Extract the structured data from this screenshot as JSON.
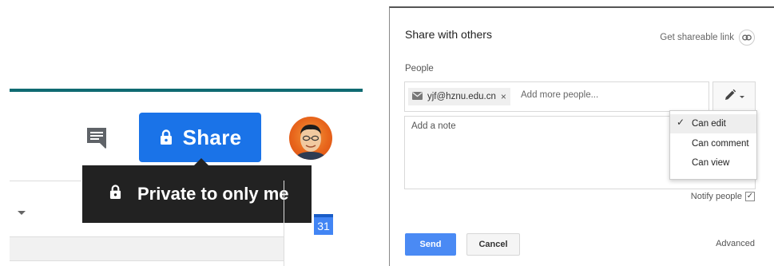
{
  "left": {
    "share_button": {
      "label": "Share",
      "icon": "lock-icon",
      "color": "#1a73e8"
    },
    "tooltip": {
      "text": "Private to only me",
      "icon": "lock-icon"
    },
    "comment_icon": "comment-icon",
    "calendar_icon": {
      "label": "31"
    },
    "accent_bar_color": "#0f6b72"
  },
  "dialog": {
    "title": "Share with others",
    "shareable_link": {
      "label": "Get shareable link",
      "icon": "link-icon"
    },
    "people_label": "People",
    "chip": {
      "email": "yjf@hznu.edu.cn",
      "close": "×",
      "icon": "mail-icon"
    },
    "add_people_placeholder": "Add more people...",
    "permission_button": {
      "icon": "pencil-icon"
    },
    "note_placeholder": "Add a note",
    "permissions_menu": [
      {
        "label": "Can edit",
        "selected": true
      },
      {
        "label": "Can comment",
        "selected": false
      },
      {
        "label": "Can view",
        "selected": false
      }
    ],
    "check_mark": "✓",
    "notify": {
      "label": "Notify people",
      "checked": true,
      "mark": "✓"
    },
    "send_label": "Send",
    "cancel_label": "Cancel",
    "advanced_label": "Advanced"
  }
}
